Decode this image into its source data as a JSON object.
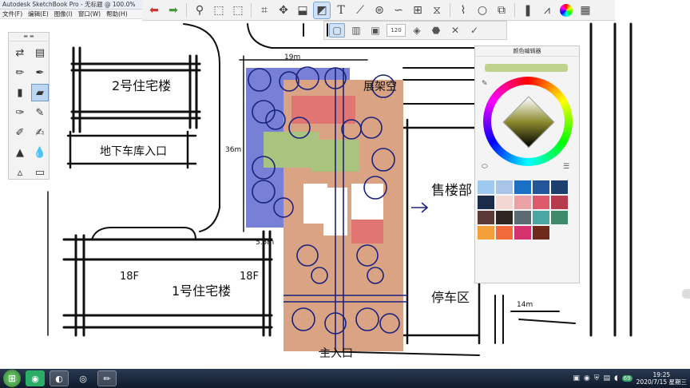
{
  "window": {
    "title": "Autodesk SketchBook Pro - 无标题 @ 100.0%"
  },
  "menu": [
    "文件(F)",
    "编辑(E)",
    "图像(I)",
    "窗口(W)",
    "帮助(H)"
  ],
  "toolbar": {
    "tools": [
      "undo-icon",
      "redo-icon",
      "zoom-icon",
      "select-icon",
      "lasso-icon",
      "crop-icon",
      "transform-icon",
      "distort-icon",
      "fill-icon",
      "text-icon",
      "ruler-icon",
      "ellipse-icon",
      "curve-icon",
      "perspective-icon",
      "symmetry-icon",
      "brush-icon",
      "circle-icon",
      "layers-icon",
      "copic-icon",
      "brushes-icon",
      "color-icon",
      "palette-icon"
    ],
    "active_tool": "fill-icon"
  },
  "fill_options": {
    "size": "120",
    "active": "solid-fill-icon"
  },
  "color_editor": {
    "title": "颜色编辑器",
    "current_color": "#bfd38f",
    "swatches": [
      "#9fc9ef",
      "#a8c4e9",
      "#1b6fc4",
      "#23559a",
      "#1c3f70",
      "#1a2c4a",
      "#f3d7d3",
      "#e9a1a6",
      "#dd5a6d",
      "#b53b4d",
      "#5b3a36",
      "#2f2420",
      "#5b6b74",
      "#4aa6a1",
      "#3f8a6a",
      "#f4a03a",
      "#f06a3a",
      "#d6336e",
      "#6f2a1c"
    ]
  },
  "plan_labels": {
    "building2": "2号住宅楼",
    "garage": "地下车库入口",
    "building1": "1号住宅楼",
    "floor_left": "18F",
    "floor_right": "18F",
    "sales": "售楼部",
    "parking": "停车区",
    "main_entrance": "主入口",
    "dim_top": "19m",
    "dim_left": "36m",
    "dim_bottom": "5.5m",
    "dim_right": "14m",
    "pavilion": "展架空"
  },
  "taskbar": {
    "apps": [
      "wechat-icon",
      "sketchbook-icon",
      "obs-icon",
      "pencil-app-icon"
    ],
    "time": "19:25",
    "date": "2020/7/15 星期三",
    "badge": "69"
  }
}
